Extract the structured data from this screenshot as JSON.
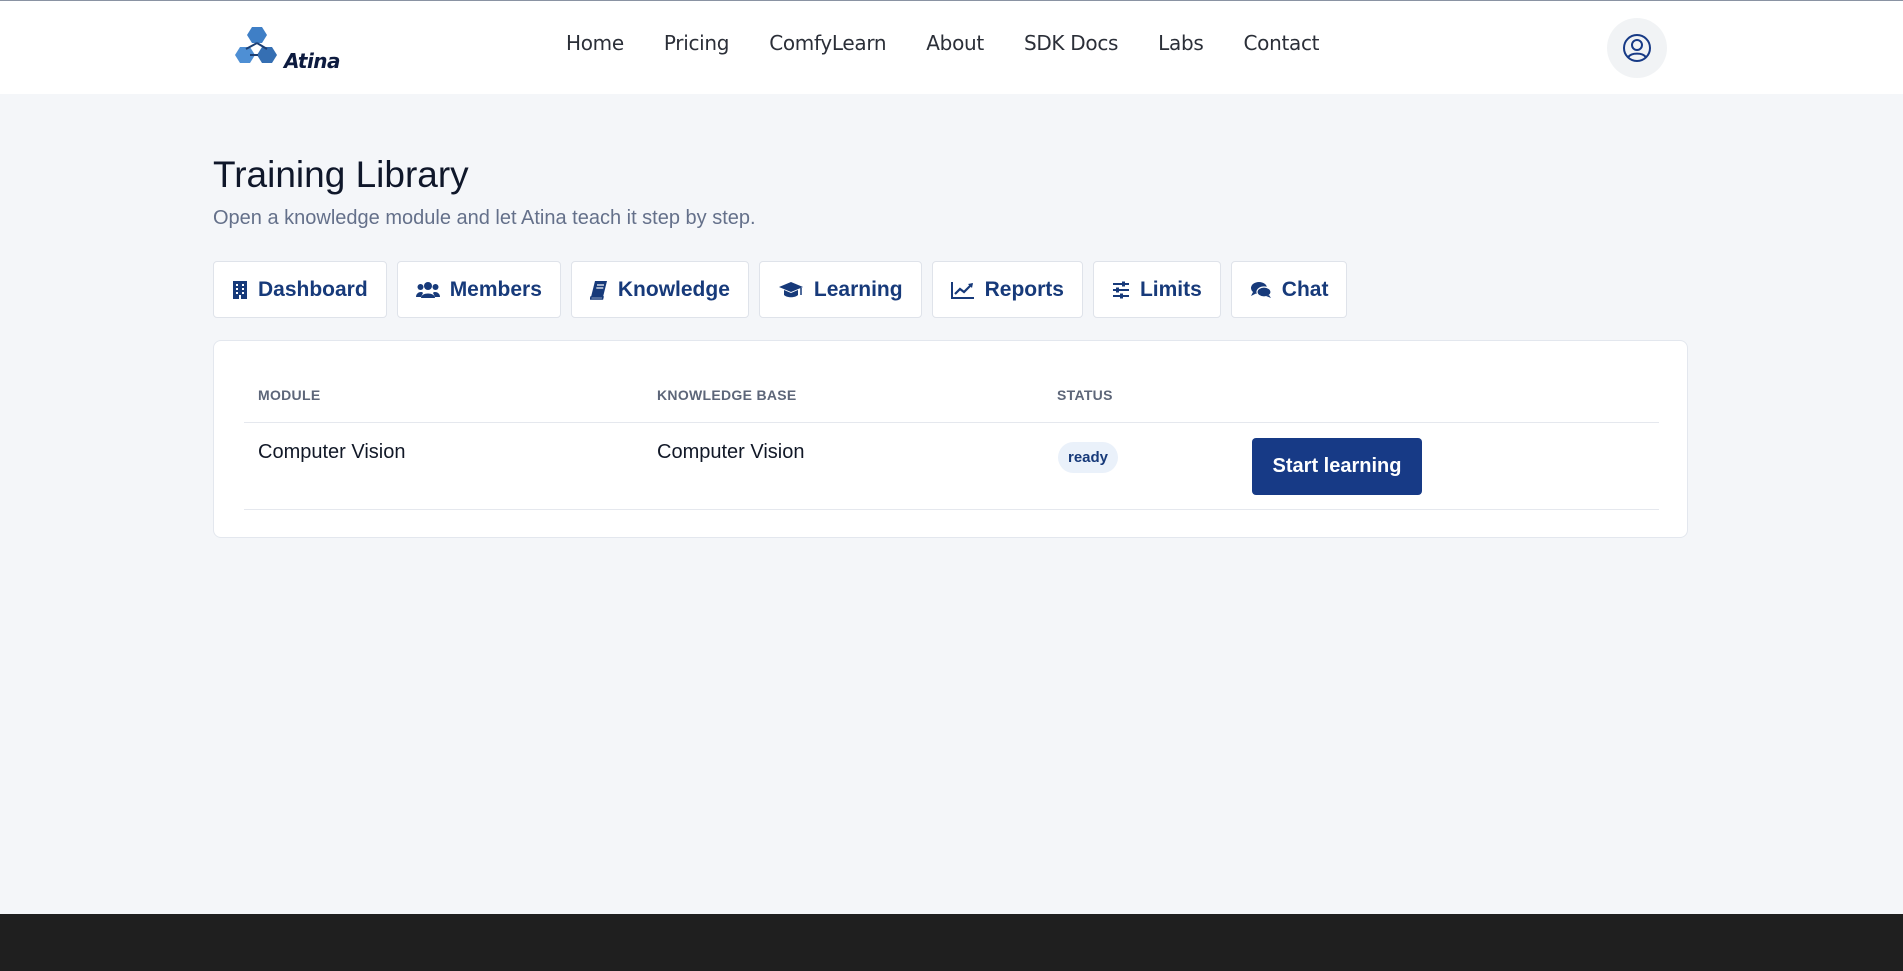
{
  "header": {
    "logo_text": "Atina",
    "nav": [
      {
        "label": "Home",
        "name": "nav-home"
      },
      {
        "label": "Pricing",
        "name": "nav-pricing"
      },
      {
        "label": "ComfyLearn",
        "name": "nav-comfylearn"
      },
      {
        "label": "About",
        "name": "nav-about"
      },
      {
        "label": "SDK Docs",
        "name": "nav-sdk-docs"
      },
      {
        "label": "Labs",
        "name": "nav-labs"
      },
      {
        "label": "Contact",
        "name": "nav-contact"
      }
    ],
    "user_icon": "user-circle-icon"
  },
  "page": {
    "title": "Training Library",
    "subtitle": "Open a knowledge module and let Atina teach it step by step."
  },
  "tabs": [
    {
      "label": "Dashboard",
      "icon": "building-icon"
    },
    {
      "label": "Members",
      "icon": "users-icon"
    },
    {
      "label": "Knowledge",
      "icon": "book-icon"
    },
    {
      "label": "Learning",
      "icon": "graduation-cap-icon"
    },
    {
      "label": "Reports",
      "icon": "line-chart-icon"
    },
    {
      "label": "Limits",
      "icon": "sliders-icon"
    },
    {
      "label": "Chat",
      "icon": "chat-bubbles-icon"
    }
  ],
  "table": {
    "columns": [
      "MODULE",
      "KNOWLEDGE BASE",
      "STATUS",
      ""
    ],
    "rows": [
      {
        "module": "Computer Vision",
        "knowledge_base": "Computer Vision",
        "status": "ready",
        "action_label": "Start learning"
      }
    ]
  },
  "colors": {
    "accent": "#173a86",
    "background": "#f4f6f9",
    "footer": "#1f1f1f",
    "badge_bg": "#eaf1fa"
  }
}
